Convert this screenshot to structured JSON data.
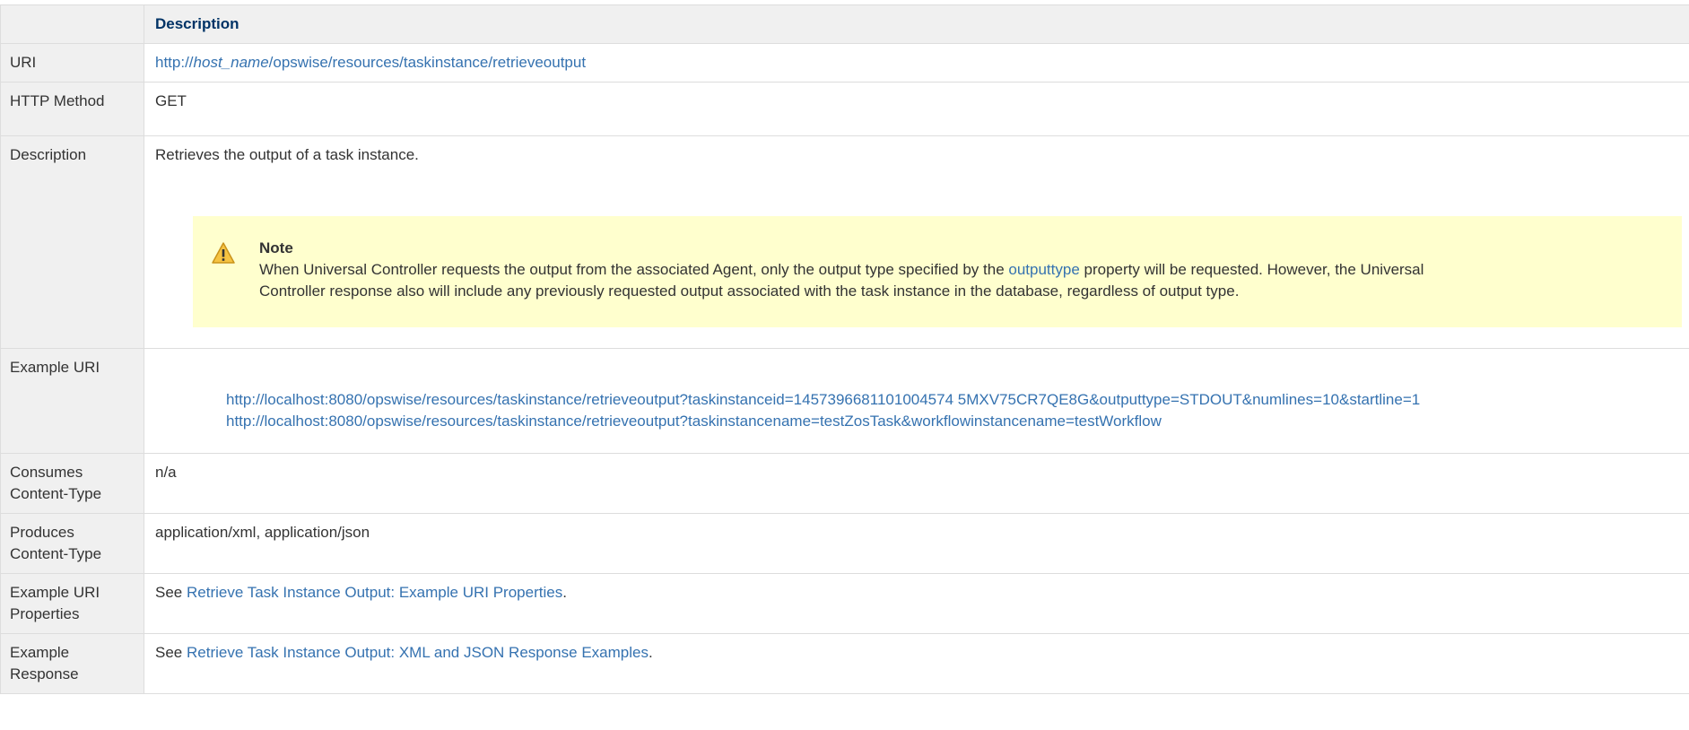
{
  "table": {
    "header": {
      "col1": "",
      "col2": "Description"
    },
    "uri": {
      "label": "URI",
      "prefix": "http://",
      "host": "host_name",
      "path": "/opswise/resources/taskinstance/retrieveoutput"
    },
    "http_method": {
      "label": "HTTP Method",
      "value": "GET"
    },
    "description": {
      "label": "Description",
      "text": "Retrieves the output of a task instance.",
      "note": {
        "title": "Note",
        "line1_pre": "When Universal Controller requests the output from the associated Agent, only the output type specified by the ",
        "line1_link": "outputtype",
        "line1_post": " property will be requested. However, the Universal",
        "line2": "Controller response also will include any previously requested output associated with the task instance in the database, regardless of output type."
      }
    },
    "example_uri": {
      "label": "Example URI",
      "items": [
        "http://localhost:8080/opswise/resources/taskinstance/retrieveoutput?taskinstanceid=1457396681101004574 5MXV75CR7QE8G&outputtype=STDOUT&numlines=10&startline=1",
        "http://localhost:8080/opswise/resources/taskinstance/retrieveoutput?taskinstancename=testZosTask&workflowinstancename=testWorkflow"
      ]
    },
    "consumes": {
      "label": "Consumes Content-Type",
      "value": "n/a"
    },
    "produces": {
      "label": "Produces Content-Type",
      "value": "application/xml, application/json"
    },
    "example_uri_properties": {
      "label": "Example URI Properties",
      "pre": "See ",
      "link": "Retrieve Task Instance Output: Example URI Properties",
      "post": "."
    },
    "example_response": {
      "label": "Example Response",
      "pre": "See ",
      "link": "Retrieve Task Instance Output: XML and JSON Response Examples",
      "post": "."
    }
  },
  "colors": {
    "header_text": "#003366",
    "link": "#3572b0",
    "note_bg": "#ffffce",
    "header_bg": "#f0f0f0",
    "border": "#dddddd"
  },
  "icons": {
    "note": "warning-icon"
  }
}
